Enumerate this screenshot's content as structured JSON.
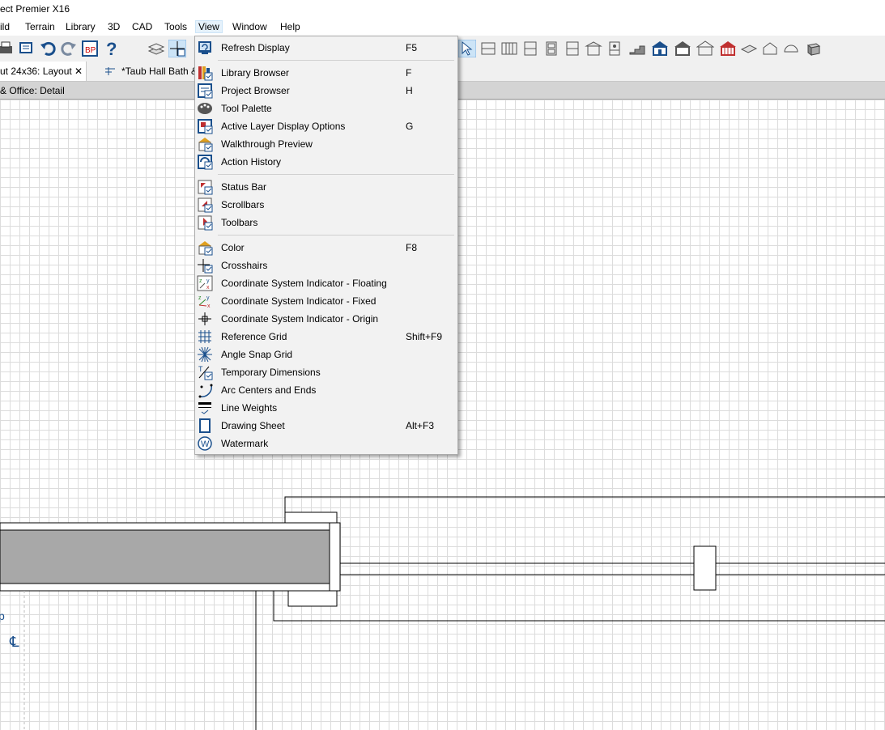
{
  "app": {
    "title": "ect Premier X16"
  },
  "menubar": [
    "ild",
    "Terrain",
    "Library",
    "3D",
    "CAD",
    "Tools",
    "View",
    "Window",
    "Help"
  ],
  "tabs": {
    "layout": "ut 24x36: Layout",
    "close": "✕",
    "plan": "*Taub Hall Bath &"
  },
  "view_title": "& Office: Detail",
  "canvas_labels": {
    "p": "p",
    "cl": "℄"
  },
  "menu": {
    "groups": [
      [
        {
          "label": "Refresh Display",
          "shortcut": "F5",
          "icon": "refresh-display-icon"
        }
      ],
      [
        {
          "label": "Library Browser",
          "shortcut": "F",
          "icon": "library-browser-icon"
        },
        {
          "label": "Project Browser",
          "shortcut": "H",
          "icon": "project-browser-icon"
        },
        {
          "label": "Tool Palette",
          "shortcut": "",
          "icon": "tool-palette-icon"
        },
        {
          "label": "Active Layer Display Options",
          "shortcut": "G",
          "icon": "layer-display-icon"
        },
        {
          "label": "Walkthrough Preview",
          "shortcut": "",
          "icon": "walkthrough-icon"
        },
        {
          "label": "Action History",
          "shortcut": "",
          "icon": "action-history-icon"
        }
      ],
      [
        {
          "label": "Status Bar",
          "shortcut": "",
          "icon": "status-bar-icon"
        },
        {
          "label": "Scrollbars",
          "shortcut": "",
          "icon": "scrollbars-icon"
        },
        {
          "label": "Toolbars",
          "shortcut": "",
          "icon": "toolbars-icon"
        }
      ],
      [
        {
          "label": "Color",
          "shortcut": "F8",
          "icon": "color-icon"
        },
        {
          "label": "Crosshairs",
          "shortcut": "",
          "icon": "crosshairs-icon"
        },
        {
          "label": "Coordinate System Indicator - Floating",
          "shortcut": "",
          "icon": "coord-floating-icon"
        },
        {
          "label": "Coordinate System Indicator - Fixed",
          "shortcut": "",
          "icon": "coord-fixed-icon"
        },
        {
          "label": "Coordinate System Indicator - Origin",
          "shortcut": "",
          "icon": "coord-origin-icon"
        },
        {
          "label": "Reference Grid",
          "shortcut": "Shift+F9",
          "icon": "reference-grid-icon"
        },
        {
          "label": "Angle Snap Grid",
          "shortcut": "",
          "icon": "angle-snap-icon"
        },
        {
          "label": "Temporary Dimensions",
          "shortcut": "",
          "icon": "temp-dimensions-icon"
        },
        {
          "label": "Arc Centers and Ends",
          "shortcut": "",
          "icon": "arc-centers-icon"
        },
        {
          "label": "Line Weights",
          "shortcut": "",
          "icon": "line-weights-icon"
        },
        {
          "label": "Drawing Sheet",
          "shortcut": "Alt+F3",
          "icon": "drawing-sheet-icon"
        },
        {
          "label": "Watermark",
          "shortcut": "",
          "icon": "watermark-icon"
        }
      ]
    ]
  },
  "colors": {
    "accent": "#1a4f8c",
    "menu_bg": "#f2f2f2",
    "grid": "#dcdcdc",
    "wall_fill": "#a8a8a8"
  }
}
